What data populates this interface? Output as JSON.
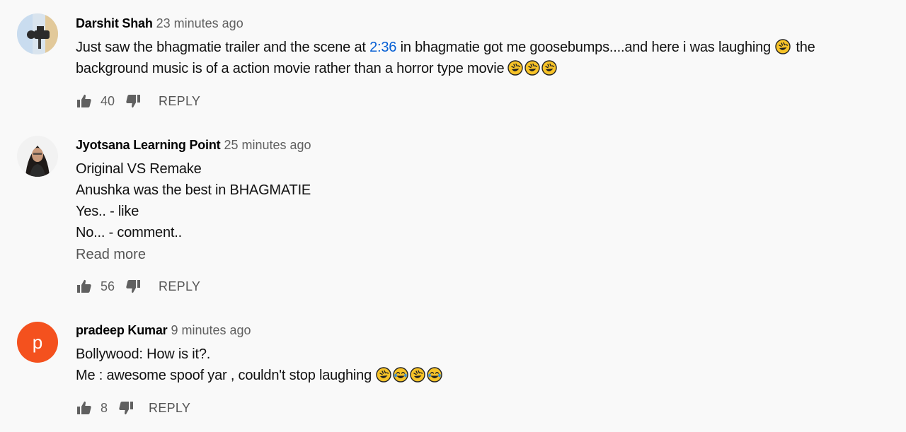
{
  "comments": [
    {
      "author": "Darshit Shah",
      "time": "23 minutes ago",
      "text_before": "Just saw the bhagmatie trailer and the scene at ",
      "timestamp_link": "2:36",
      "text_after": " in bhagmatie got me goosebumps....and here i was laughing",
      "text_after_emoji": " the",
      "line2": "background music is of a action movie rather than a horror type movie",
      "likes": "40",
      "reply_label": "REPLY"
    },
    {
      "author": "Jyotsana Learning Point",
      "time": "25 minutes ago",
      "lines": [
        "Original VS Remake",
        "Anushka was the best in BHAGMATIE",
        "Yes.. - like",
        "No... - comment.."
      ],
      "read_more": "Read more",
      "likes": "56",
      "reply_label": "REPLY"
    },
    {
      "author": "pradeep Kumar",
      "avatar_letter": "p",
      "time": "9 minutes ago",
      "lines": [
        "Bollywood: How is it?.",
        "Me : awesome spoof yar , couldn't stop laughing"
      ],
      "likes": "8",
      "reply_label": "REPLY"
    }
  ],
  "colors": {
    "timestamp_link": "#065fd4",
    "avatar_p": "#f4511e",
    "emoji": "#f7c328"
  },
  "icons": {
    "like": "thumb-up-icon",
    "dislike": "thumb-down-icon",
    "emoji_rofl": "rolling-laughing-emoji",
    "emoji_joy": "tears-of-joy-emoji"
  }
}
